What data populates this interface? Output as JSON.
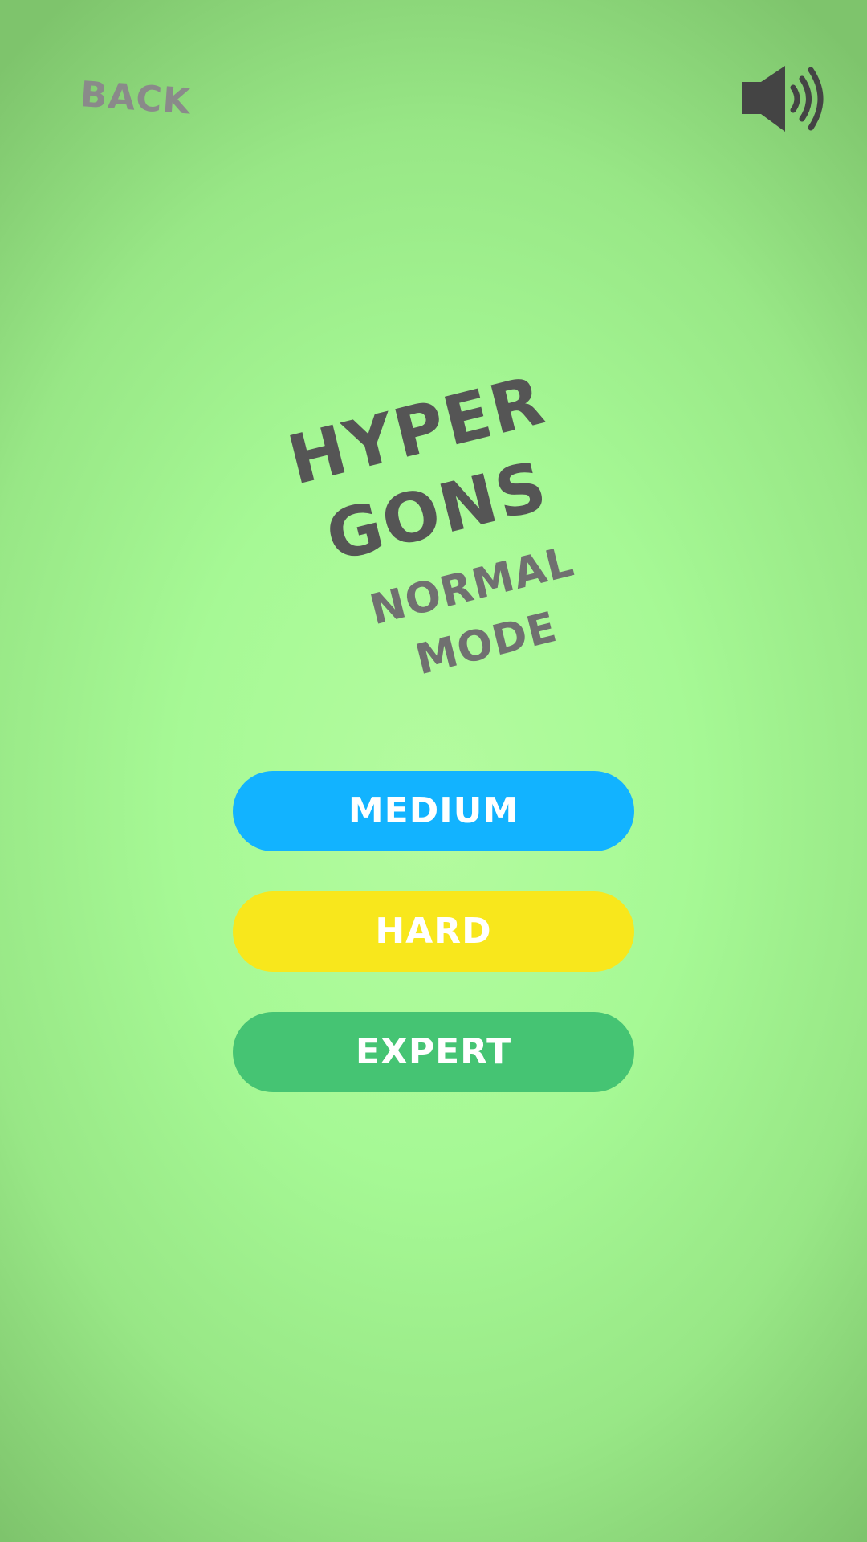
{
  "nav": {
    "back_label": "BACK",
    "sound_icon": "speaker-volume-icon"
  },
  "title": {
    "line1": "HYPER",
    "line2": "GONS",
    "mode": "NORMAL MODE"
  },
  "buttons": [
    {
      "label": "MEDIUM",
      "color": "#12b3ff"
    },
    {
      "label": "HARD",
      "color": "#f8e71c"
    },
    {
      "label": "EXPERT",
      "color": "#45c473"
    }
  ],
  "colors": {
    "title_text": "#555555",
    "mode_text": "#707070",
    "back_text": "#8a8a8a",
    "icon": "#444444"
  }
}
